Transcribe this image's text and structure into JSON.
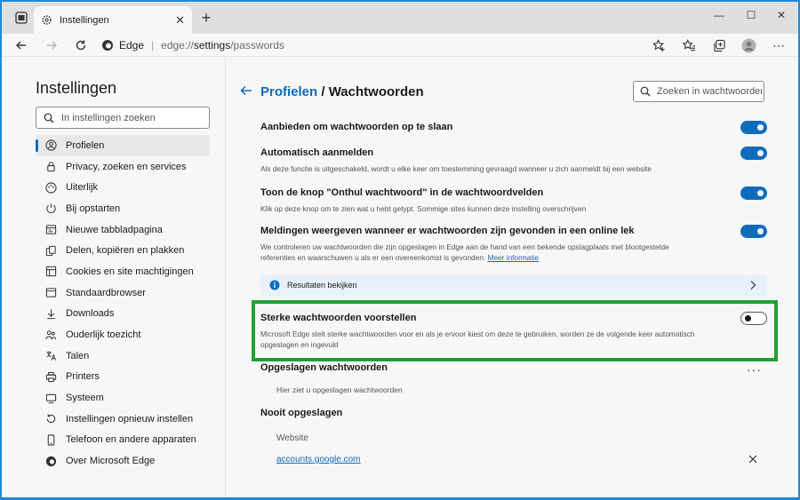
{
  "browser": {
    "tab_title": "Instellingen",
    "tab_close": "✕",
    "new_tab": "+",
    "window_controls": [
      "—",
      "☐",
      "✕"
    ],
    "address": {
      "brand": "Edge",
      "separator": "|",
      "url_scheme": "edge://",
      "url_path": "settings",
      "url_rest": "/passwords"
    },
    "toolbar_icons": [
      "star-add-icon",
      "favorites-icon",
      "collections-icon",
      "profile-avatar-icon",
      "more-icon"
    ],
    "more_label": "⋯"
  },
  "sidebar": {
    "title": "Instellingen",
    "search_placeholder": "In instellingen zoeken",
    "items": [
      {
        "label": "Profielen",
        "icon": "profile-icon",
        "active": true
      },
      {
        "label": "Privacy, zoeken en services",
        "icon": "lock-icon"
      },
      {
        "label": "Uiterlijk",
        "icon": "appearance-icon"
      },
      {
        "label": "Bij opstarten",
        "icon": "power-icon"
      },
      {
        "label": "Nieuwe tabbladpagina",
        "icon": "newtab-icon"
      },
      {
        "label": "Delen, kopiëren en plakken",
        "icon": "share-icon"
      },
      {
        "label": "Cookies en site machtigingen",
        "icon": "cookies-icon"
      },
      {
        "label": "Standaardbrowser",
        "icon": "browser-icon"
      },
      {
        "label": "Downloads",
        "icon": "download-icon"
      },
      {
        "label": "Ouderlijk toezicht",
        "icon": "family-icon"
      },
      {
        "label": "Talen",
        "icon": "language-icon"
      },
      {
        "label": "Printers",
        "icon": "printer-icon"
      },
      {
        "label": "Systeem",
        "icon": "system-icon"
      },
      {
        "label": "Instellingen opnieuw instellen",
        "icon": "reset-icon"
      },
      {
        "label": "Telefoon en andere apparaten",
        "icon": "phone-icon"
      },
      {
        "label": "Over Microsoft Edge",
        "icon": "edge-icon"
      }
    ]
  },
  "main": {
    "breadcrumb_link": "Profielen",
    "breadcrumb_sep": " / ",
    "breadcrumb_current": "Wachtwoorden",
    "search_placeholder": "Zoeken in wachtwoorden",
    "settings": [
      {
        "title": "Aanbieden om wachtwoorden op te slaan",
        "desc": "",
        "on": true
      },
      {
        "title": "Automatisch aanmelden",
        "desc": "Als deze functie is uitgeschakeld, wordt u elke keer om toestemming gevraagd wanneer u zich aanmeldt bij een website",
        "on": true
      },
      {
        "title": "Toon de knop \"Onthul wachtwoord\" in de wachtwoordvelden",
        "desc": "Klik op deze knop om te zien wat u hebt getypt. Sommige sites kunnen deze instelling overschrijven",
        "on": true
      },
      {
        "title": "Meldingen weergeven wanneer er wachtwoorden zijn gevonden in een online lek",
        "desc": "We controleren uw wachtwoorden die zijn opgeslagen in Edge aan de hand van een bekende opslagplaats met blootgestelde referenties en waarschuwen u als er een overeenkomst is gevonden.",
        "link": "Meer informatie",
        "on": true
      }
    ],
    "results_label": "Resultaten bekijken",
    "strong": {
      "title": "Sterke wachtwoorden voorstellen",
      "desc": "Microsoft Edge stelt sterke wachtwoorden voor en als je ervoor kiest om deze te gebruiken, worden ze de volgende keer automatisch opgeslagen en ingevuld",
      "on": false
    },
    "saved_title": "Opgeslagen wachtwoorden",
    "saved_more": "···",
    "saved_empty": "Hier ziet u opgeslagen wachtwoorden",
    "never_title": "Nooit opgeslagen",
    "never_col": "Website",
    "never_sites": [
      "accounts.google.com"
    ],
    "highlight_color": "#21a038",
    "accent": "#0f6cbd"
  }
}
